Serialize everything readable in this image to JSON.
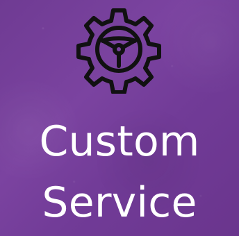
{
  "tile": {
    "title_lines": [
      "Custom",
      "Service"
    ]
  },
  "icon": {
    "name": "gear-steering-wheel-icon"
  },
  "colors": {
    "background": "#7441a0",
    "text": "#ffffff",
    "icon_stroke": "#111111"
  }
}
